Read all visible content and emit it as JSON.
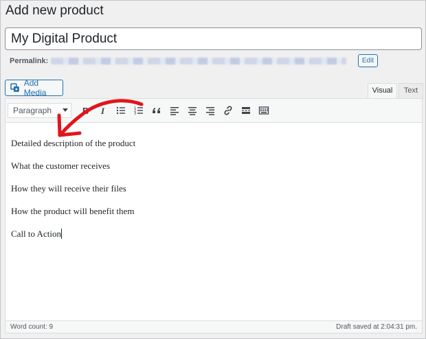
{
  "page": {
    "title": "Add new product"
  },
  "product": {
    "title_value": "My Digital Product",
    "permalink_label": "Permalink:",
    "edit_label": "Edit"
  },
  "media": {
    "add_media_label": "Add Media"
  },
  "tabs": {
    "visual": "Visual",
    "text": "Text"
  },
  "toolbar": {
    "format_selected": "Paragraph",
    "buttons": [
      "bold-icon",
      "italic-icon",
      "bullet-list-icon",
      "numbered-list-icon",
      "blockquote-icon",
      "align-left-icon",
      "align-center-icon",
      "align-right-icon",
      "link-icon",
      "read-more-icon",
      "toolbar-toggle-icon"
    ]
  },
  "content": {
    "paragraphs": [
      "Detailed description of the product",
      "What the customer receives",
      "How they will receive their files",
      "How the product will benefit them",
      "Call to Action"
    ]
  },
  "status": {
    "word_count": "Word count: 9",
    "draft_saved": "Draft saved at 2:04:31 pm."
  },
  "colors": {
    "accent": "#2271b1",
    "annotation": "#e0161b"
  }
}
